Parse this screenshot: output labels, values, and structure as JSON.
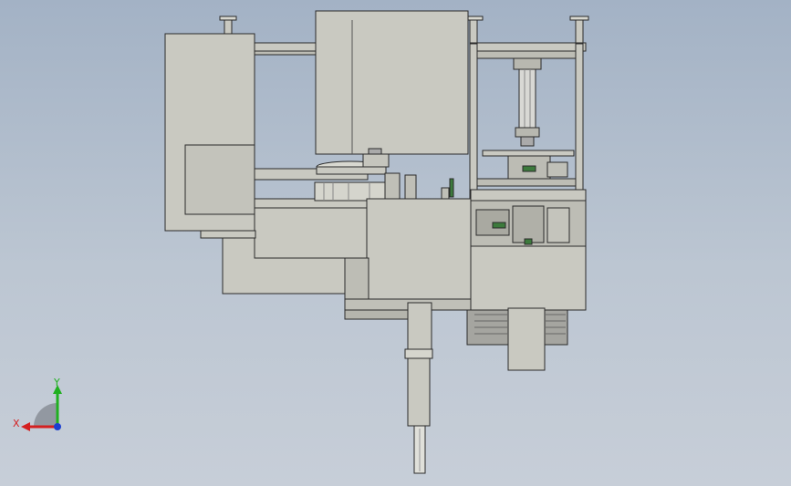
{
  "viewport": {
    "background_top": "#a3b2c5",
    "background_bottom": "#c7ced8"
  },
  "model": {
    "description_icon": "cad-assembly-front-view",
    "body_fill": "#c9c9c1",
    "body_stroke": "#2a2a2a",
    "accent_green": "#3c7a3c",
    "accent_red": "#b03030"
  },
  "triad": {
    "x_label": "X",
    "y_label": "Y",
    "x_color": "#d42020",
    "y_color": "#20b020",
    "z_color": "#1c3fd0"
  }
}
